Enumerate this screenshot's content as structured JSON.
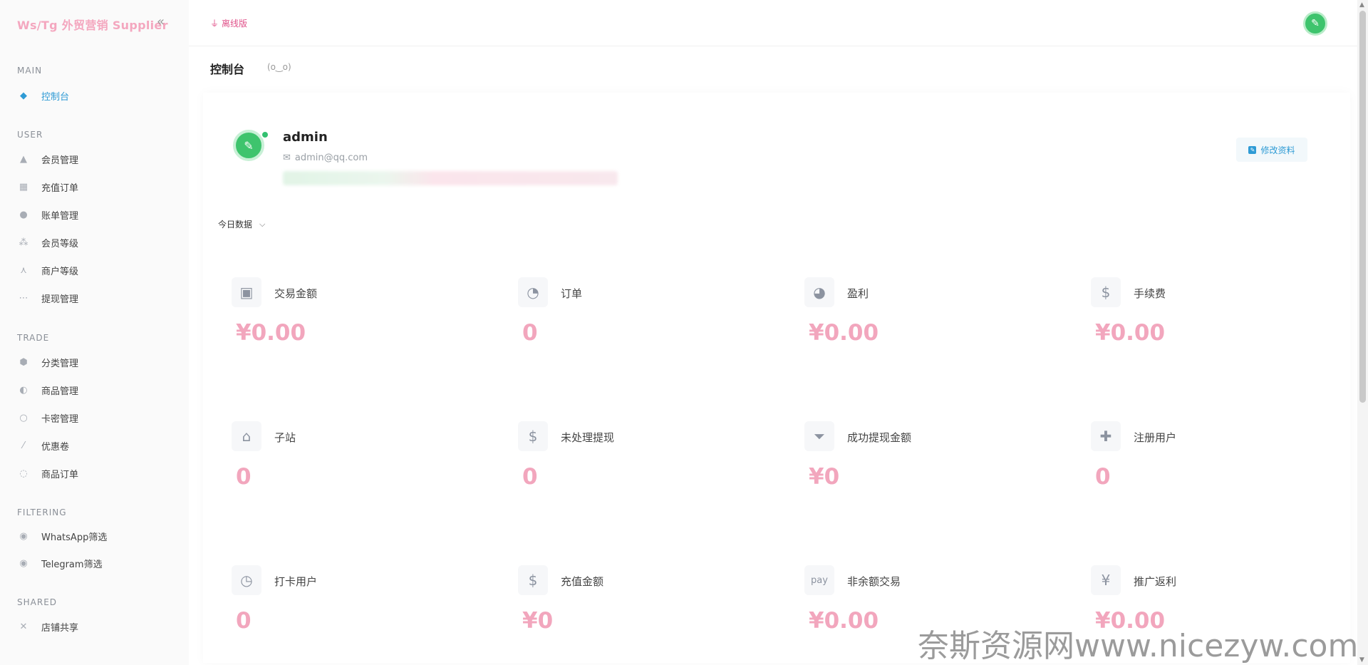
{
  "sidebar": {
    "brand": "Ws/Tg 外贸营销 Supplier",
    "collapse_icon": "«",
    "sections": {
      "main": "MAIN",
      "user": "USER",
      "trade": "TRADE",
      "filtering": "FILTERING",
      "shared": "SHARED"
    },
    "items": {
      "dashboard": "控制台",
      "members": "会员管理",
      "recharge_orders": "充值订单",
      "bills": "账单管理",
      "member_levels": "会员等级",
      "merchant_levels": "商户等级",
      "withdraw": "提现管理",
      "categories": "分类管理",
      "products": "商品管理",
      "cards": "卡密管理",
      "coupons": "优惠卷",
      "product_orders": "商品订单",
      "whatsapp_filter": "WhatsApp筛选",
      "telegram_filter": "Telegram筛选",
      "shop_share": "店铺共享"
    }
  },
  "topbar": {
    "offline_label": "离线版"
  },
  "page": {
    "title": "控制台",
    "subtitle": "(o‿o)"
  },
  "profile": {
    "username": "admin",
    "email": "admin@qq.com",
    "edit_label": "修改资料"
  },
  "range": {
    "selected": "今日数据"
  },
  "stats": [
    {
      "label": "交易金额",
      "value": "¥0.00",
      "icon": "shopping-bag-icon"
    },
    {
      "label": "订单",
      "value": "0",
      "icon": "pie-chart-icon"
    },
    {
      "label": "盈利",
      "value": "¥0.00",
      "icon": "pie-chart-icon"
    },
    {
      "label": "手续费",
      "value": "¥0.00",
      "icon": "money-hand-icon"
    },
    {
      "label": "子站",
      "value": "0",
      "icon": "house-laptop-icon"
    },
    {
      "label": "未处理提现",
      "value": "0",
      "icon": "dollar-square-icon"
    },
    {
      "label": "成功提现金额",
      "value": "¥0",
      "icon": "funnel-dollar-icon"
    },
    {
      "label": "注册用户",
      "value": "0",
      "icon": "user-plus-icon"
    },
    {
      "label": "打卡用户",
      "value": "0",
      "icon": "clock-icon"
    },
    {
      "label": "充值金额",
      "value": "¥0",
      "icon": "hand-dollar-icon"
    },
    {
      "label": "非余额交易",
      "value": "¥0.00",
      "icon": "pay-icon"
    },
    {
      "label": "推广返利",
      "value": "¥0.00",
      "icon": "yen-icon"
    }
  ],
  "watermark": "奈斯资源网www.nicezyw.com",
  "colors": {
    "accent": "#2f9bd5",
    "value_pink": "#f2a6bd",
    "brand_pink": "#f4a7bf",
    "offline_red": "#e0528a",
    "avatar_green": "#3ec46d"
  }
}
